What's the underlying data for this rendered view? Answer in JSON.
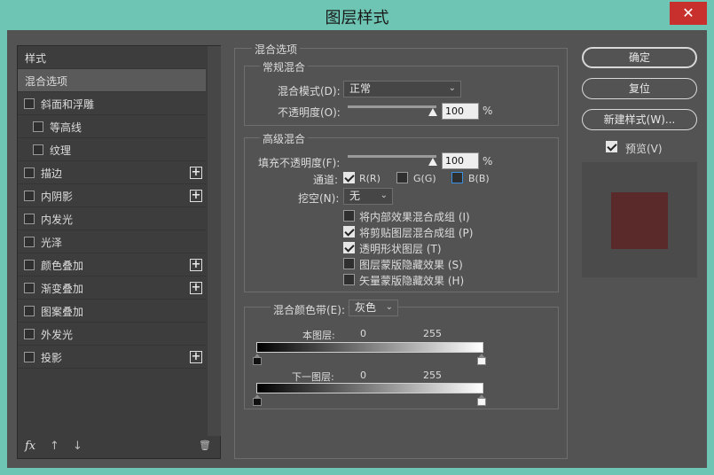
{
  "window": {
    "title": "图层样式",
    "close_glyph": "✕"
  },
  "styles": {
    "header": "样式",
    "selected": "混合选项",
    "items": [
      {
        "label": "斜面和浮雕",
        "has_plus": false,
        "indent": false
      },
      {
        "label": "等高线",
        "has_plus": false,
        "indent": true
      },
      {
        "label": "纹理",
        "has_plus": false,
        "indent": true
      },
      {
        "label": "描边",
        "has_plus": true,
        "indent": false
      },
      {
        "label": "内阴影",
        "has_plus": true,
        "indent": false
      },
      {
        "label": "内发光",
        "has_plus": false,
        "indent": false
      },
      {
        "label": "光泽",
        "has_plus": false,
        "indent": false
      },
      {
        "label": "颜色叠加",
        "has_plus": true,
        "indent": false
      },
      {
        "label": "渐变叠加",
        "has_plus": true,
        "indent": false
      },
      {
        "label": "图案叠加",
        "has_plus": false,
        "indent": false
      },
      {
        "label": "外发光",
        "has_plus": false,
        "indent": false
      },
      {
        "label": "投影",
        "has_plus": true,
        "indent": false
      }
    ],
    "bottom": {
      "fx": "fx",
      "up_icon": "↑",
      "down_icon": "↓",
      "trash_icon": "🗑"
    }
  },
  "blend": {
    "title": "混合选项",
    "general": {
      "title": "常规混合",
      "mode_label": "混合模式(D):",
      "mode_value": "正常",
      "opacity_label": "不透明度(O):",
      "opacity_value": "100",
      "unit": "%"
    },
    "advanced": {
      "title": "高级混合",
      "fill_label": "填充不透明度(F):",
      "fill_value": "100",
      "unit": "%",
      "channels_label": "通道:",
      "channels": [
        {
          "label": "R(R)",
          "checked": true
        },
        {
          "label": "G(G)",
          "checked": false
        },
        {
          "label": "B(B)",
          "checked": false
        }
      ],
      "knockout_label": "挖空(N):",
      "knockout_value": "无",
      "options": [
        {
          "label": "将内部效果混合成组 (I)",
          "checked": false
        },
        {
          "label": "将剪贴图层混合成组 (P)",
          "checked": true
        },
        {
          "label": "透明形状图层 (T)",
          "checked": true
        },
        {
          "label": "图层蒙版隐藏效果 (S)",
          "checked": false
        },
        {
          "label": "矢量蒙版隐藏效果 (H)",
          "checked": false
        }
      ]
    },
    "blendif": {
      "label": "混合颜色带(E):",
      "value": "灰色",
      "this_layer": "本图层:",
      "underlying": "下一图层:",
      "min": "0",
      "max": "255"
    }
  },
  "buttons": {
    "ok": "确定",
    "reset": "复位",
    "new_style": "新建样式(W)...",
    "preview": "预览(V)",
    "preview_checked": true
  },
  "colors": {
    "accent": "#6ec5b3",
    "close": "#c7302d",
    "swatch": "#5a2a2a"
  }
}
